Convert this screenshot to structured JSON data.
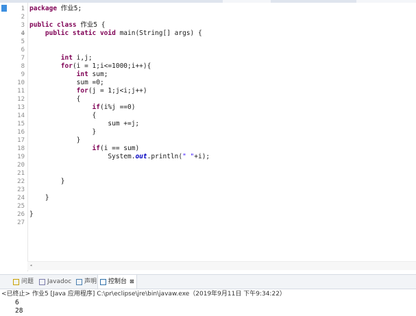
{
  "editor": {
    "lines": [
      {
        "n": "1",
        "tokens": [
          {
            "t": "package",
            "c": "kw"
          },
          {
            "t": " 作业5;",
            "c": ""
          }
        ]
      },
      {
        "n": "2",
        "tokens": []
      },
      {
        "n": "3",
        "tokens": [
          {
            "t": "public class",
            "c": "kw"
          },
          {
            "t": " 作业5 {",
            "c": ""
          }
        ]
      },
      {
        "n": "4",
        "tokens": [
          {
            "t": "    ",
            "c": ""
          },
          {
            "t": "public static void",
            "c": "kw"
          },
          {
            "t": " main(String[] args) {",
            "c": ""
          }
        ]
      },
      {
        "n": "5",
        "tokens": []
      },
      {
        "n": "6",
        "tokens": []
      },
      {
        "n": "7",
        "tokens": [
          {
            "t": "        ",
            "c": ""
          },
          {
            "t": "int",
            "c": "kw"
          },
          {
            "t": " i,j;",
            "c": ""
          }
        ]
      },
      {
        "n": "8",
        "tokens": [
          {
            "t": "        ",
            "c": ""
          },
          {
            "t": "for",
            "c": "kw"
          },
          {
            "t": "(i = 1;i<=1000;i++){",
            "c": ""
          }
        ]
      },
      {
        "n": "9",
        "tokens": [
          {
            "t": "            ",
            "c": ""
          },
          {
            "t": "int",
            "c": "kw"
          },
          {
            "t": " sum;",
            "c": ""
          }
        ]
      },
      {
        "n": "10",
        "tokens": [
          {
            "t": "            sum =0;",
            "c": ""
          }
        ]
      },
      {
        "n": "11",
        "tokens": [
          {
            "t": "            ",
            "c": ""
          },
          {
            "t": "for",
            "c": "kw"
          },
          {
            "t": "(j = 1;j<i;j++)",
            "c": ""
          }
        ]
      },
      {
        "n": "12",
        "tokens": [
          {
            "t": "            {",
            "c": ""
          }
        ]
      },
      {
        "n": "13",
        "tokens": [
          {
            "t": "                ",
            "c": ""
          },
          {
            "t": "if",
            "c": "kw"
          },
          {
            "t": "(i%j ==0)",
            "c": ""
          }
        ]
      },
      {
        "n": "14",
        "tokens": [
          {
            "t": "                {",
            "c": ""
          }
        ]
      },
      {
        "n": "15",
        "tokens": [
          {
            "t": "                    sum +=j;",
            "c": ""
          }
        ]
      },
      {
        "n": "16",
        "tokens": [
          {
            "t": "                }",
            "c": ""
          }
        ]
      },
      {
        "n": "17",
        "tokens": [
          {
            "t": "            }",
            "c": ""
          }
        ]
      },
      {
        "n": "18",
        "tokens": [
          {
            "t": "                ",
            "c": ""
          },
          {
            "t": "if",
            "c": "kw"
          },
          {
            "t": "(i == sum)",
            "c": ""
          }
        ]
      },
      {
        "n": "19",
        "tokens": [
          {
            "t": "                    System.",
            "c": ""
          },
          {
            "t": "out",
            "c": "fld"
          },
          {
            "t": ".println(",
            "c": ""
          },
          {
            "t": "\" \"",
            "c": "str"
          },
          {
            "t": "+i);",
            "c": ""
          }
        ]
      },
      {
        "n": "20",
        "tokens": []
      },
      {
        "n": "21",
        "tokens": []
      },
      {
        "n": "22",
        "tokens": [
          {
            "t": "        }",
            "c": ""
          }
        ]
      },
      {
        "n": "23",
        "tokens": []
      },
      {
        "n": "24",
        "tokens": [
          {
            "t": "    }",
            "c": ""
          }
        ]
      },
      {
        "n": "25",
        "tokens": []
      },
      {
        "n": "26",
        "tokens": [
          {
            "t": "}",
            "c": ""
          }
        ]
      },
      {
        "n": "27",
        "tokens": []
      }
    ],
    "scroll_arrow": "◂"
  },
  "panel": {
    "tabs": [
      {
        "label": "问题",
        "icon": "problems-icon",
        "active": false
      },
      {
        "label": "Javadoc",
        "icon": "javadoc-icon",
        "active": false
      },
      {
        "label": "声明",
        "icon": "declaration-icon",
        "active": false
      },
      {
        "label": "控制台",
        "icon": "console-icon",
        "active": true
      }
    ],
    "close_glyph": "⊠"
  },
  "console": {
    "header": "<已终止> 作业5 [Java 应用程序] C:\\pr\\eclipse\\jre\\bin\\javaw.exe（2019年9月11日 下午9:34:22）",
    "output": [
      "6",
      "28"
    ]
  },
  "colors": {
    "keyword": "#7f0055",
    "field": "#0000c0",
    "string": "#2a00ff",
    "line_number": "#8a8a8a"
  }
}
